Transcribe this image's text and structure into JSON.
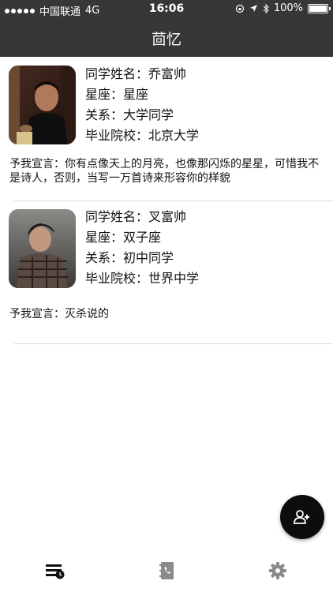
{
  "status_bar": {
    "carrier": "中国联通",
    "network": "4G",
    "time": "16:06",
    "battery": "100%"
  },
  "navbar": {
    "title": "茴忆"
  },
  "cards": [
    {
      "name_label": "同学姓名：",
      "name": "乔富帅",
      "zodiac_label": "星座：",
      "zodiac": "星座",
      "relation_label": "关系：",
      "relation": "大学同学",
      "school_label": "毕业院校：",
      "school": "北京大学",
      "declaration_label": "予我宣言：",
      "declaration": "你有点像天上的月亮，也像那闪烁的星星，可惜我不是诗人，否则，当写一万首诗来形容你的样貌"
    },
    {
      "name_label": "同学姓名：",
      "name": "叉富帅",
      "zodiac_label": "星座：",
      "zodiac": "双子座",
      "relation_label": "关系：",
      "relation": "初中同学",
      "school_label": "毕业院校：",
      "school": "世界中学",
      "declaration_label": "予我宣言：",
      "declaration": "灭杀说的"
    }
  ],
  "fab": {
    "icon": "add-person-icon"
  },
  "tabbar": {
    "icons": [
      "list-clock-icon",
      "phone-book-icon",
      "gear-icon"
    ]
  }
}
